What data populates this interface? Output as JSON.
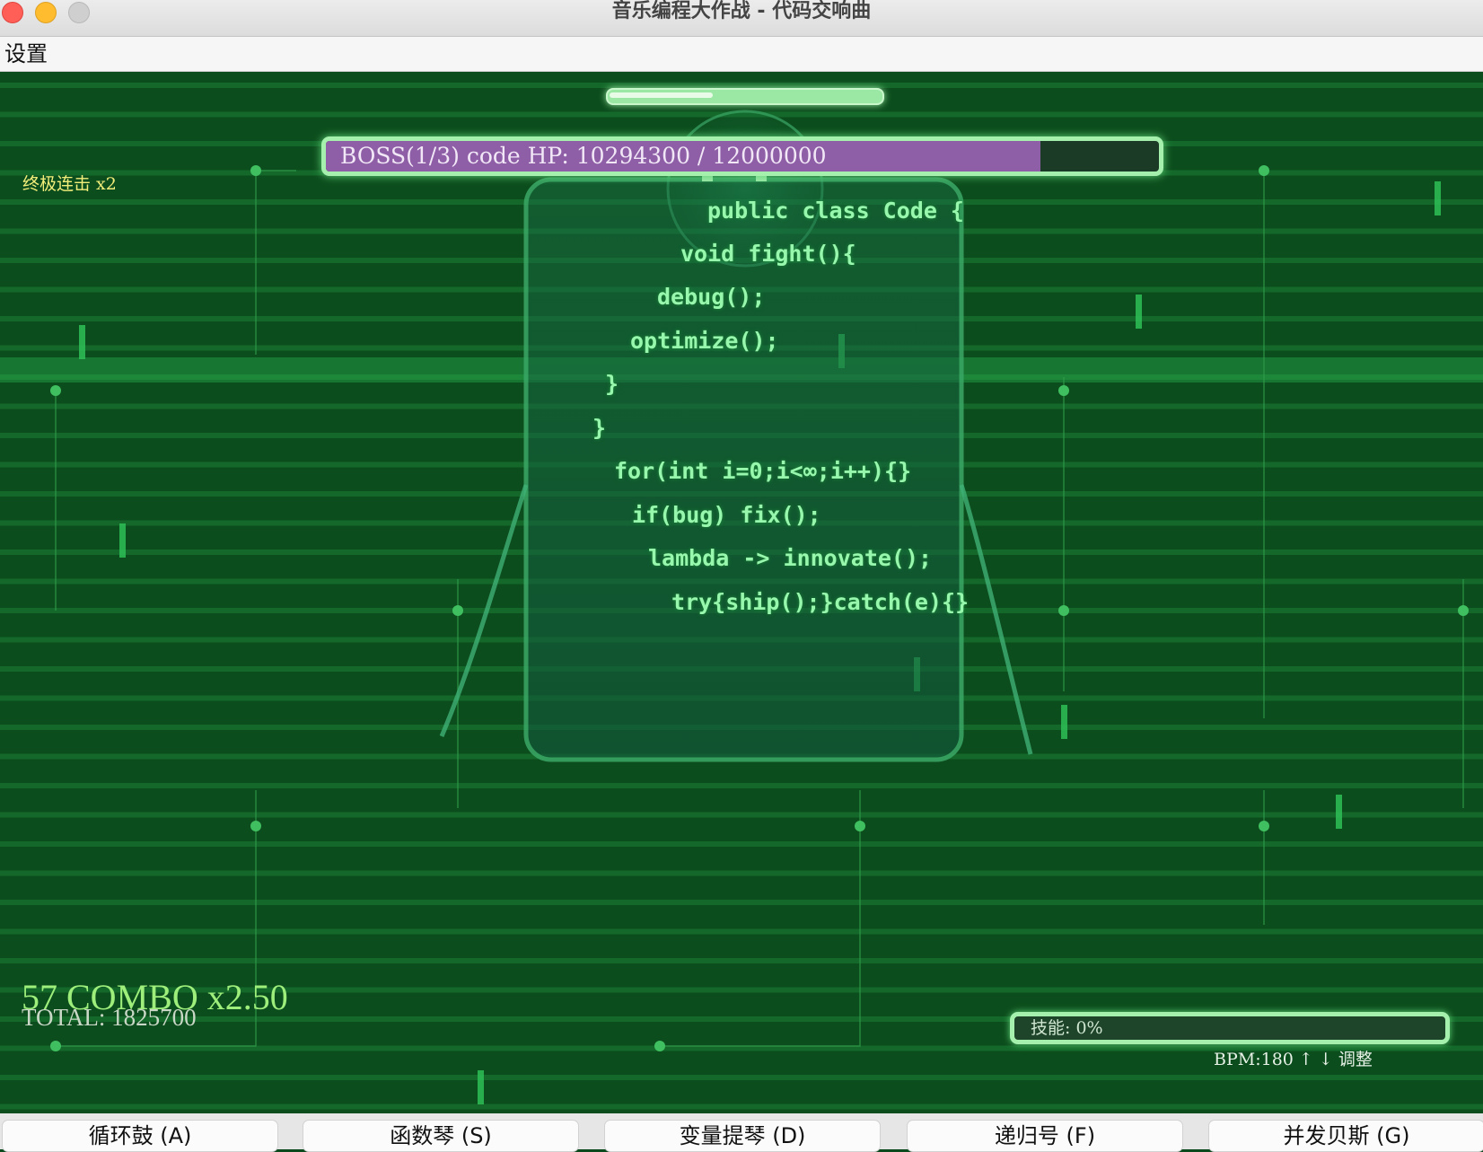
{
  "window": {
    "title": "音乐编程大作战 - 代码交响曲"
  },
  "menu": {
    "settings_label": "设置"
  },
  "hud": {
    "top_progress_fraction": 0.39,
    "boss": {
      "label": "BOSS(1/3) code HP: 10294300 / 12000000",
      "hp_current": 10294300,
      "hp_max": 12000000,
      "phase": "1/3",
      "fill_color": "#8e5fa6"
    },
    "ultimate_combo": "终极连击 x2",
    "combo": "57 COMBO x2.50",
    "total": "TOTAL: 1825700",
    "skill": {
      "label": "技能: 0%",
      "percent": 0
    },
    "bpm": "BPM:180 ↑ ↓ 调整"
  },
  "boss_code": {
    "lines": [
      "public class Code {",
      "void fight(){",
      "debug();",
      "optimize();",
      "}",
      "}",
      "for(int i=0;i<∞;i++){}",
      "if(bug) fix();",
      "lambda -> innovate();",
      "try{ship();}catch(e){}"
    ]
  },
  "colors": {
    "background": "#0c4d1d",
    "code_text": "#97f7ac",
    "bar_border": "#a6f0ae",
    "combo_text": "#9dee7b",
    "ultimate_text": "#f2ee7a"
  },
  "instrument_buttons": [
    "循环鼓 (A)",
    "函数琴 (S)",
    "变量提琴 (D)",
    "递归号 (F)",
    "并发贝斯 (G)"
  ]
}
